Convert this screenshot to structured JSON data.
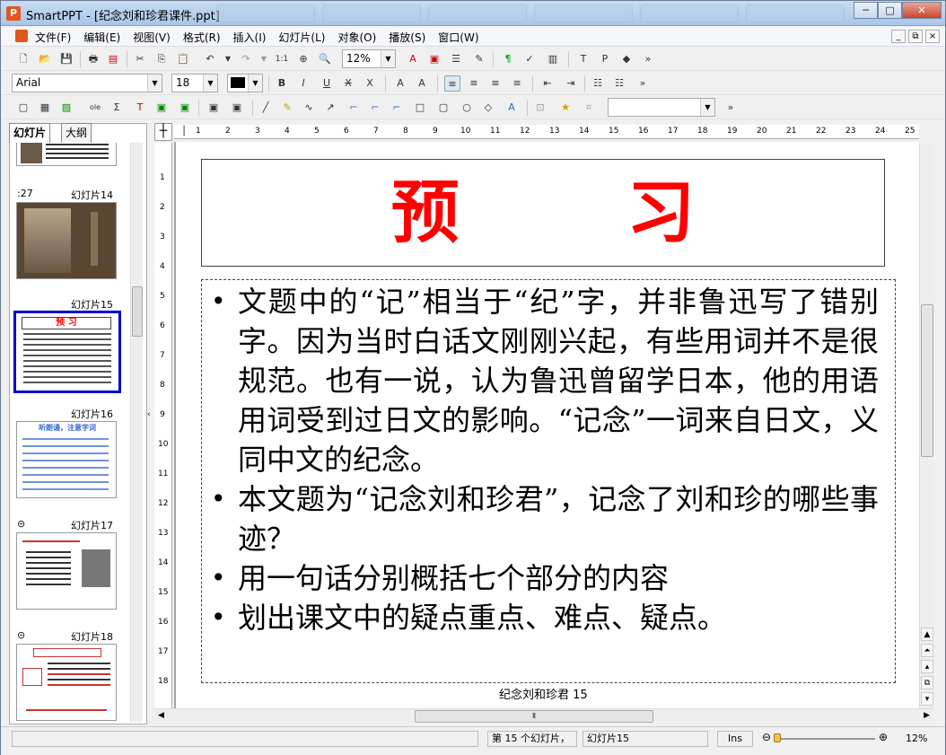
{
  "window": {
    "title": "SmartPPT - [纪念刘和珍君课件.ppt]",
    "app_icon": "P",
    "buttons": {
      "minimize": "─",
      "maximize": "□",
      "close": "✕"
    }
  },
  "menu": {
    "items": [
      "文件(F)",
      "编辑(E)",
      "视图(V)",
      "格式(R)",
      "插入(I)",
      "幻灯片(L)",
      "对象(O)",
      "播放(S)",
      "窗口(W)"
    ],
    "mdi": [
      "_",
      "⧉",
      "×"
    ]
  },
  "toolbar1": {
    "zoom": "12%",
    "more": "»"
  },
  "toolbar2": {
    "font": "Arial",
    "size": "18",
    "more": "»"
  },
  "toolbar3": {
    "more": "»"
  },
  "panel": {
    "tabs": [
      "幻灯片",
      "大纲"
    ],
    "slides": [
      {
        "label": "",
        "time": ""
      },
      {
        "label": "幻灯片14",
        "time": ":27"
      },
      {
        "label": "幻灯片15",
        "time": ""
      },
      {
        "label": "幻灯片16",
        "time": ""
      },
      {
        "label": "幻灯片17",
        "time": ""
      },
      {
        "label": "幻灯片18",
        "time": ""
      }
    ]
  },
  "ruler": {
    "h": [
      "1",
      "2",
      "3",
      "4",
      "5",
      "6",
      "7",
      "8",
      "9",
      "10",
      "11",
      "12",
      "13",
      "14",
      "15",
      "16",
      "17",
      "18",
      "19",
      "20",
      "21",
      "22",
      "23",
      "24",
      "25"
    ],
    "v": [
      "1",
      "2",
      "3",
      "4",
      "5",
      "6",
      "7",
      "8",
      "9",
      "10",
      "11",
      "12",
      "13",
      "14",
      "15",
      "16",
      "17",
      "18"
    ]
  },
  "slide": {
    "title": "预 习",
    "bullets": [
      "文题中的“记”相当于“纪”字，并非鲁迅写了错别字。因为当时白话文刚刚兴起，有些用词并不是很规范。也有一说，认为鲁迅曾留学日本，他的用语用词受到过日文的影响。“记念”一词来自日文，义同中文的纪念。",
      "本文题为“记念刘和珍君”，记念了刘和珍的哪些事迹？",
      "用一句话分别概括七个部分的内容",
      "划出课文中的疑点重点、难点、疑点。"
    ],
    "footer": "纪念刘和珍君 15",
    "title_color": "#ff0000"
  },
  "status": {
    "slide_position": "第 15 个幻灯片，",
    "slide_name": "幻灯片15",
    "mode": "Ins",
    "zoom": "12%"
  }
}
